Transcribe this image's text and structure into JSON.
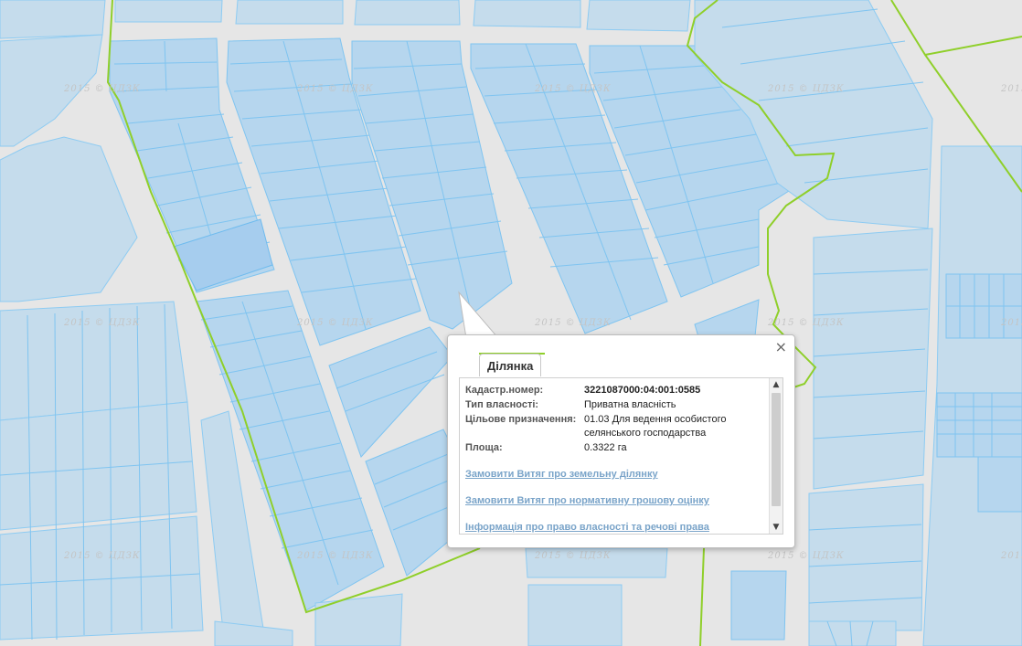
{
  "map": {
    "watermark": "2015 © ЦДЗК",
    "colors": {
      "background": "#e6e6e6",
      "parcel_fill": "#b6d6ee",
      "parcel_stroke": "#7fc4f0",
      "boundary": "#8fcf2a"
    }
  },
  "popup": {
    "close_label": "×",
    "tab_label": "Ділянка",
    "fields": [
      {
        "key": "Кадастр.номер:",
        "value": "3221087000:04:001:0585",
        "bold": true
      },
      {
        "key": "Тип власності:",
        "value": "Приватна власність",
        "bold": false
      },
      {
        "key": "Цільове призначення:",
        "value": "01.03 Для ведення особистого селянського господарства",
        "bold": false
      },
      {
        "key": "Площа:",
        "value": "0.3322 га",
        "bold": false
      }
    ],
    "links": [
      "Замовити Витяг про земельну ділянку",
      "Замовити Витяг про нормативну грошову оцінку",
      "Інформація про право власності та речові права"
    ],
    "scrollbar": {
      "up": "▲",
      "down": "▼"
    }
  }
}
